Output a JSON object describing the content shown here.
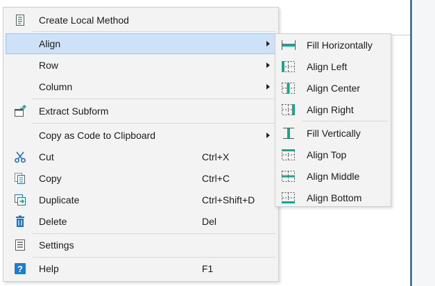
{
  "menu": {
    "items": [
      {
        "label": "Create Local Method",
        "icon": "method-icon"
      },
      {
        "label": "Align",
        "icon": "",
        "submenu": true
      },
      {
        "label": "Row",
        "icon": "",
        "submenu": true
      },
      {
        "label": "Column",
        "icon": "",
        "submenu": true
      },
      {
        "label": "Extract Subform",
        "icon": "extract-subform-icon"
      },
      {
        "label": "Copy as Code to Clipboard",
        "icon": "",
        "submenu": true
      },
      {
        "label": "Cut",
        "icon": "scissors-icon",
        "shortcut": "Ctrl+X"
      },
      {
        "label": "Copy",
        "icon": "copy-icon",
        "shortcut": "Ctrl+C"
      },
      {
        "label": "Duplicate",
        "icon": "duplicate-icon",
        "shortcut": "Ctrl+Shift+D"
      },
      {
        "label": "Delete",
        "icon": "trash-icon",
        "shortcut": "Del"
      },
      {
        "label": "Settings",
        "icon": "settings-icon"
      },
      {
        "label": "Help",
        "icon": "help-icon",
        "shortcut": "F1"
      }
    ],
    "highlighted": "Align"
  },
  "submenu": {
    "parent": "Align",
    "items": [
      {
        "label": "Fill Horizontally",
        "icon": "fill-horizontally-icon"
      },
      {
        "label": "Align Left",
        "icon": "align-left-icon"
      },
      {
        "label": "Align Center",
        "icon": "align-center-icon"
      },
      {
        "label": "Align Right",
        "icon": "align-right-icon"
      },
      {
        "label": "Fill Vertically",
        "icon": "fill-vertically-icon"
      },
      {
        "label": "Align Top",
        "icon": "align-top-icon"
      },
      {
        "label": "Align Middle",
        "icon": "align-middle-icon"
      },
      {
        "label": "Align Bottom",
        "icon": "align-bottom-icon"
      }
    ]
  },
  "colors": {
    "accent": "#1aa58c",
    "highlight": "#cde1f7",
    "icon_blue": "#1f6fbf"
  }
}
